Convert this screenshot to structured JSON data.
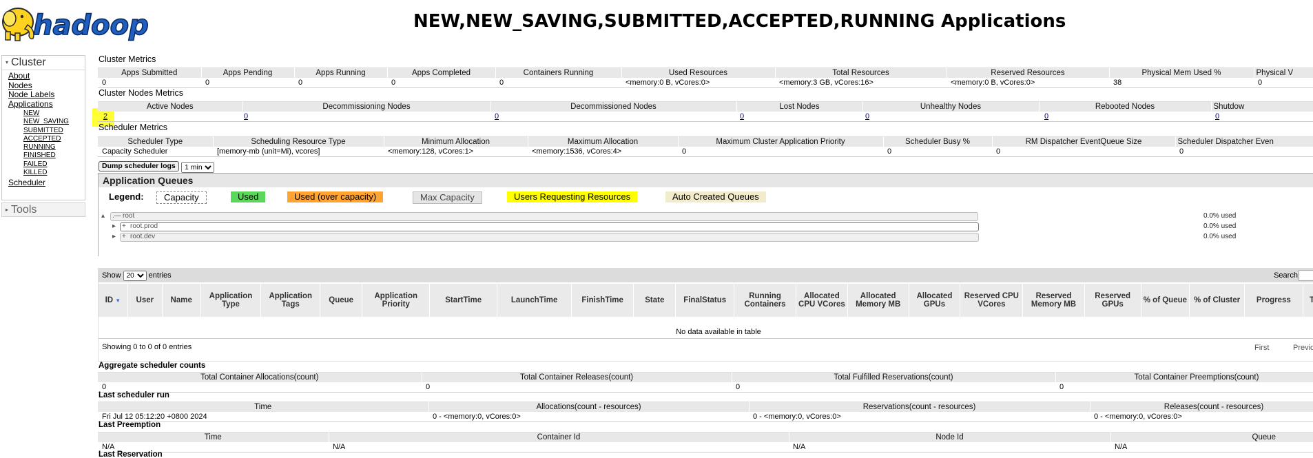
{
  "header": {
    "logo_text": "hadoop",
    "title": "NEW,NEW_SAVING,SUBMITTED,ACCEPTED,RUNNING Applications"
  },
  "nav": {
    "cluster_label": "Cluster",
    "links": {
      "about": "About",
      "nodes": "Nodes",
      "node_labels": "Node Labels",
      "applications": "Applications",
      "states": [
        "NEW",
        "NEW_SAVING",
        "SUBMITTED",
        "ACCEPTED",
        "RUNNING",
        "FINISHED",
        "FAILED",
        "KILLED"
      ],
      "scheduler": "Scheduler"
    },
    "tools_label": "Tools"
  },
  "cluster_metrics": {
    "title": "Cluster Metrics",
    "headers": [
      "Apps Submitted",
      "Apps Pending",
      "Apps Running",
      "Apps Completed",
      "Containers Running",
      "Used Resources",
      "Total Resources",
      "Reserved Resources",
      "Physical Mem Used %",
      "Physical V"
    ],
    "values": [
      "0",
      "0",
      "0",
      "0",
      "0",
      "<memory:0 B, vCores:0>",
      "<memory:3 GB, vCores:16>",
      "<memory:0 B, vCores:0>",
      "38",
      "0"
    ]
  },
  "nodes_metrics": {
    "title": "Cluster Nodes Metrics",
    "headers": [
      "Active Nodes",
      "Decommissioning Nodes",
      "Decommissioned Nodes",
      "Lost Nodes",
      "Unhealthy Nodes",
      "Rebooted Nodes",
      "Shutdow"
    ],
    "values": [
      "2",
      "0",
      "0",
      "0",
      "0",
      "0",
      "0"
    ]
  },
  "scheduler_metrics": {
    "title": "Scheduler Metrics",
    "headers": [
      "Scheduler Type",
      "Scheduling Resource Type",
      "Minimum Allocation",
      "Maximum Allocation",
      "Maximum Cluster Application Priority",
      "Scheduler Busy %",
      "RM Dispatcher EventQueue Size",
      "Scheduler Dispatcher Even"
    ],
    "values": [
      "Capacity Scheduler",
      "[memory-mb (unit=Mi), vcores]",
      "<memory:128, vCores:1>",
      "<memory:1536, vCores:4>",
      "0",
      "0",
      "0",
      "0"
    ]
  },
  "dump": {
    "button": "Dump scheduler logs",
    "interval": "1 min"
  },
  "queues": {
    "title": "Application Queues",
    "legend_label": "Legend:",
    "legend": {
      "capacity": "Capacity",
      "used": "Used",
      "used_over": "Used (over capacity)",
      "max_capacity": "Max Capacity",
      "users_requesting": "Users Requesting Resources",
      "auto_created": "Auto Created Queues"
    },
    "colors": {
      "used": "#5bd75b",
      "over": "#ffa333",
      "requesting": "#ffff00",
      "auto": "#f3eccc"
    },
    "tree": [
      {
        "name": "root",
        "expander": "▴",
        "prefix": ".—",
        "used": "0.0% used"
      },
      {
        "name": "root.prod",
        "expander": "▸",
        "prefix": "+",
        "used": "0.0% used"
      },
      {
        "name": "root.dev",
        "expander": "▸",
        "prefix": "+",
        "used": "0.0% used"
      }
    ]
  },
  "apps_table": {
    "show_label": "Show",
    "entries_label": "entries",
    "page_size": "20",
    "search_label": "Search:",
    "columns": [
      "ID",
      "User",
      "Name",
      "Application Type",
      "Application Tags",
      "Queue",
      "Application Priority",
      "StartTime",
      "LaunchTime",
      "FinishTime",
      "State",
      "FinalStatus",
      "Running Containers",
      "Allocated CPU VCores",
      "Allocated Memory MB",
      "Allocated GPUs",
      "Reserved CPU VCores",
      "Reserved Memory MB",
      "Reserved GPUs",
      "% of Queue",
      "% of Cluster",
      "Progress",
      "Track U"
    ],
    "empty": "No data available in table",
    "showing": "Showing 0 to 0 of 0 entries",
    "first": "First",
    "previous": "Previo"
  },
  "aggregate": {
    "title": "Aggregate scheduler counts",
    "headers": [
      "Total Container Allocations(count)",
      "Total Container Releases(count)",
      "Total Fulfilled Reservations(count)",
      "Total Container Preemptions(count)"
    ],
    "values": [
      "0",
      "0",
      "0",
      "0"
    ]
  },
  "last_run": {
    "title": "Last scheduler run",
    "headers": [
      "Time",
      "Allocations(count - resources)",
      "Reservations(count - resources)",
      "Releases(count - resources)"
    ],
    "values": [
      "Fri Jul 12 05:12:20 +0800 2024",
      "0 - <memory:0, vCores:0>",
      "0 - <memory:0, vCores:0>",
      "0 - <memory:0, vCores:0>"
    ]
  },
  "last_preemption": {
    "title": "Last Preemption",
    "headers": [
      "Time",
      "Container Id",
      "Node Id",
      "Queue"
    ],
    "values": [
      "N/A",
      "N/A",
      "N/A",
      "N/A"
    ]
  },
  "last_reservation": {
    "title": "Last Reservation"
  }
}
